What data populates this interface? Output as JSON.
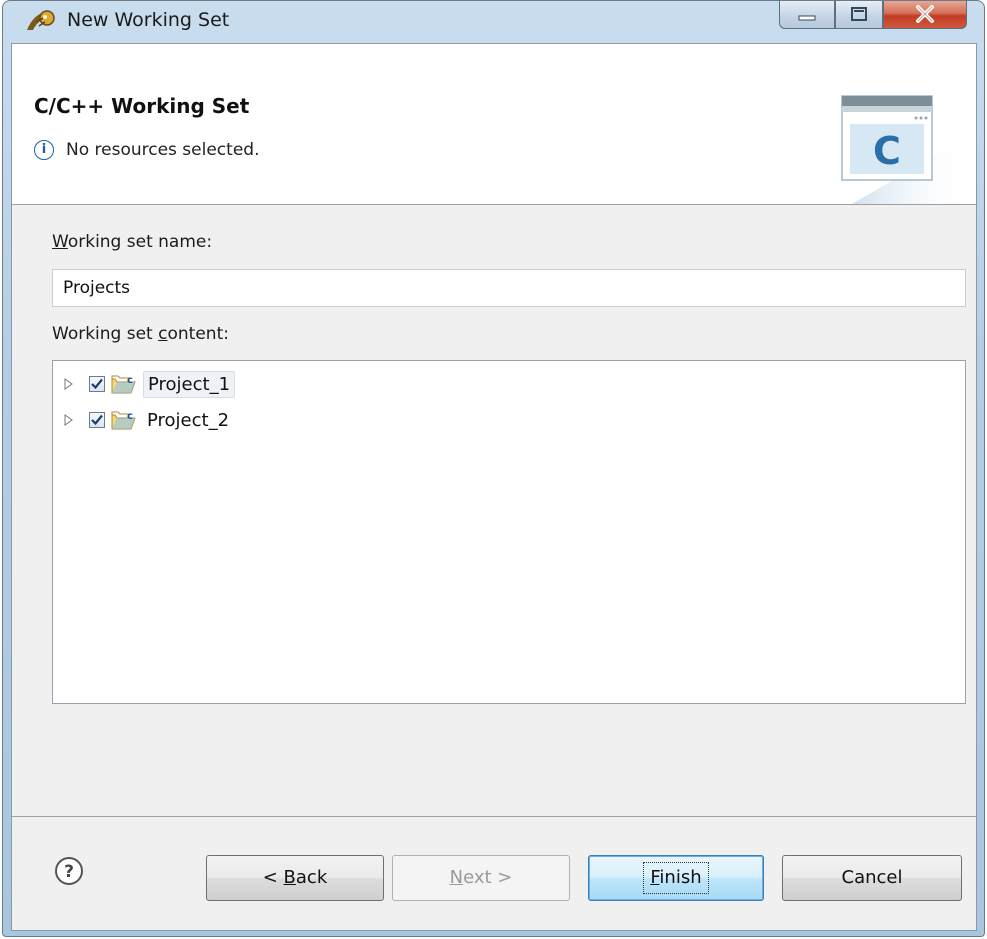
{
  "window": {
    "title": "New Working Set"
  },
  "banner": {
    "title": "C/C++ Working Set",
    "message": "No resources selected."
  },
  "form": {
    "name_label_underline": "W",
    "name_label_rest": "orking set name:",
    "name_value": "Projects",
    "content_label_pre": "Working set ",
    "content_label_underline": "c",
    "content_label_post": "ontent:"
  },
  "tree": {
    "items": [
      {
        "label": "Project_1",
        "checked": true,
        "selected": true
      },
      {
        "label": "Project_2",
        "checked": true,
        "selected": false
      }
    ]
  },
  "buttons": {
    "back_pre": "< ",
    "back_underline": "B",
    "back_post": "ack",
    "next_underline": "N",
    "next_post": "ext >",
    "finish_underline": "F",
    "finish_post": "inish",
    "cancel": "Cancel"
  },
  "icons": {
    "app": "eclipse-icon",
    "info": "info-icon",
    "help": "help-icon",
    "wizard": "c-working-set-wizard-image",
    "project": "c-project-folder-icon"
  },
  "colors": {
    "accent": "#1d5fa5",
    "close_button": "#c23b22"
  }
}
